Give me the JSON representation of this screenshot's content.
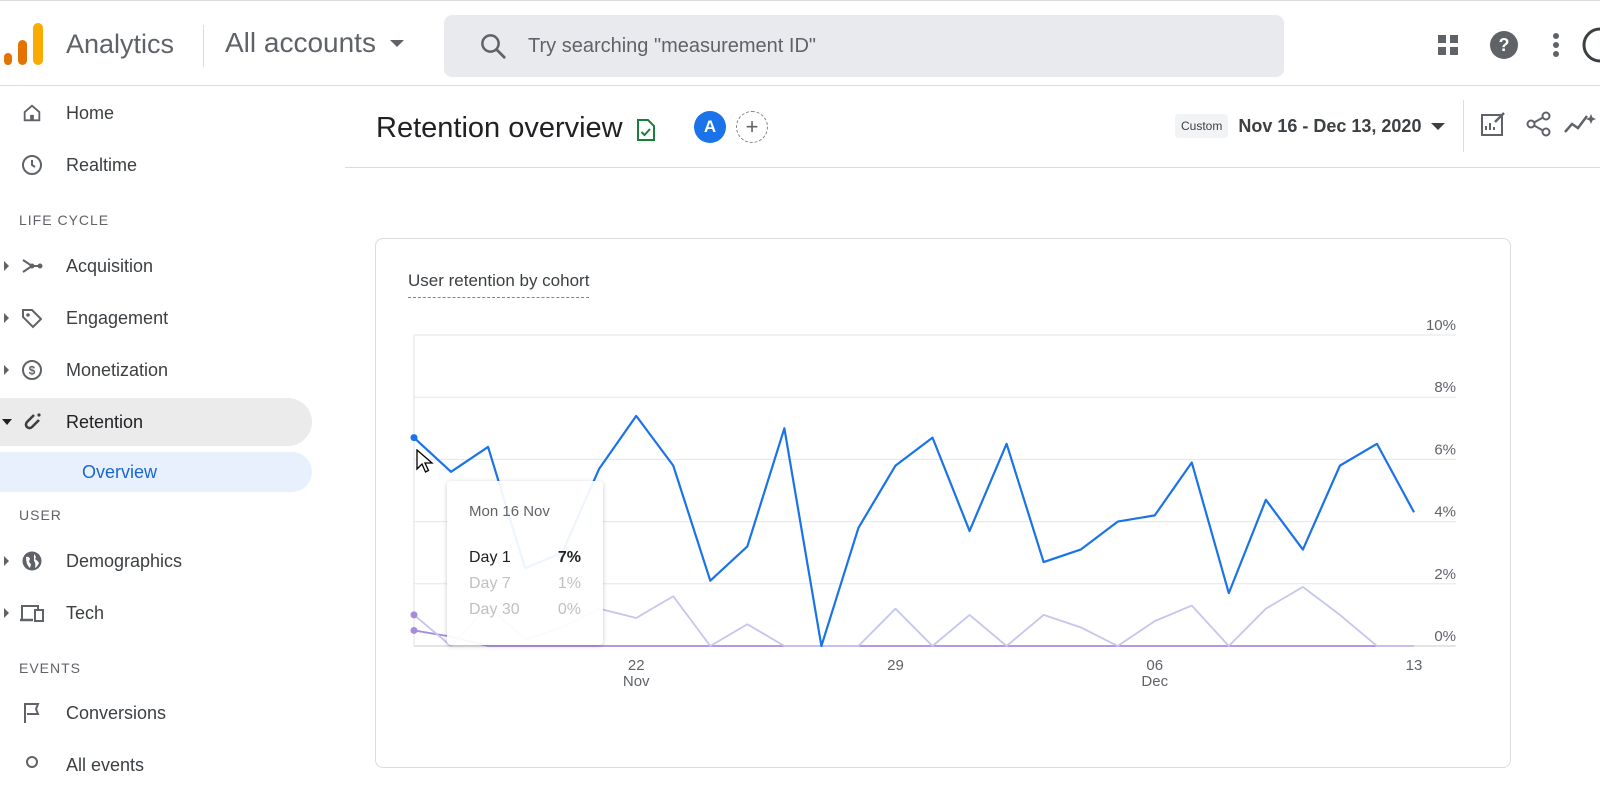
{
  "topbar": {
    "app_title": "Analytics",
    "account": "All accounts",
    "search_placeholder": "Try searching \"measurement ID\"",
    "icons": [
      "apps-grid-icon",
      "help-icon",
      "more-vert-icon",
      "account-avatar-icon"
    ]
  },
  "sidebar": {
    "home": "Home",
    "realtime": "Realtime",
    "section_lifecycle": "LIFE CYCLE",
    "acquisition": "Acquisition",
    "engagement": "Engagement",
    "monetization": "Monetization",
    "retention": "Retention",
    "overview": "Overview",
    "section_user": "USER",
    "demographics": "Demographics",
    "tech": "Tech",
    "section_events": "EVENTS",
    "conversions": "Conversions",
    "all_events": "All events"
  },
  "header": {
    "title": "Retention overview",
    "avatar_letter": "A",
    "add_comparison": "+",
    "custom_label": "Custom",
    "date_range": "Nov 16 - Dec 13, 2020"
  },
  "card": {
    "title": "User retention by cohort"
  },
  "tooltip": {
    "date": "Mon 16 Nov",
    "rows": [
      {
        "label": "Day 1",
        "value": "7%"
      },
      {
        "label": "Day 7",
        "value": "1%"
      },
      {
        "label": "Day 30",
        "value": "0%"
      }
    ]
  },
  "colors": {
    "accent": "#1a73e8",
    "day1": "#1a73e8",
    "day7": "#c5c5ef",
    "day30": "#a78bdb",
    "active_nav_bg": "#ebebeb",
    "sub_nav_bg": "#e8f0fe"
  },
  "chart_data": {
    "type": "line",
    "title": "User retention by cohort",
    "x": [
      "2020-11-16",
      "2020-11-17",
      "2020-11-18",
      "2020-11-19",
      "2020-11-20",
      "2020-11-21",
      "2020-11-22",
      "2020-11-23",
      "2020-11-24",
      "2020-11-25",
      "2020-11-26",
      "2020-11-27",
      "2020-11-28",
      "2020-11-29",
      "2020-11-30",
      "2020-12-01",
      "2020-12-02",
      "2020-12-03",
      "2020-12-04",
      "2020-12-05",
      "2020-12-06",
      "2020-12-07",
      "2020-12-08",
      "2020-12-09",
      "2020-12-10",
      "2020-12-11",
      "2020-12-12",
      "2020-12-13"
    ],
    "x_tick_labels": [
      {
        "date": "2020-11-22",
        "line1": "22",
        "line2": "Nov"
      },
      {
        "date": "2020-11-29",
        "line1": "29",
        "line2": ""
      },
      {
        "date": "2020-12-06",
        "line1": "06",
        "line2": "Dec"
      },
      {
        "date": "2020-12-13",
        "line1": "13",
        "line2": ""
      }
    ],
    "y_ticks": [
      "0%",
      "2%",
      "4%",
      "6%",
      "8%",
      "10%"
    ],
    "ylim": [
      0,
      10
    ],
    "grid": true,
    "series": [
      {
        "values": [
          6.7,
          5.6,
          6.4,
          2.5,
          3.0,
          5.7,
          7.4,
          5.8,
          2.1,
          3.2,
          7.0,
          0.0,
          3.8,
          5.8,
          6.7,
          3.7,
          6.5,
          2.7,
          3.1,
          4.0,
          4.2,
          5.9,
          1.7,
          4.7,
          3.1,
          5.8,
          6.5,
          4.3
        ]
      },
      {
        "values": [
          1.0,
          0.0,
          1.3,
          0.2,
          0.6,
          1.2,
          0.9,
          1.6,
          0.0,
          0.7,
          0.0,
          0.0,
          0.0,
          1.2,
          0.0,
          1.0,
          0.0,
          1.0,
          0.6,
          0.0,
          0.8,
          1.3,
          0.0,
          1.2,
          1.9,
          1.0,
          0.0,
          0.0
        ]
      },
      {
        "values": [
          0.5,
          0.3,
          0.0,
          0.0,
          0.0,
          0.0,
          0.0,
          0.0,
          0.0,
          0.0,
          0.0,
          0.0,
          0.0,
          0.0,
          0.0,
          0.0,
          0.0,
          0.0,
          0.0,
          0.0,
          0.0,
          0.0,
          0.0,
          0.0,
          0.0,
          0.0,
          0.0,
          0.0
        ]
      }
    ]
  }
}
